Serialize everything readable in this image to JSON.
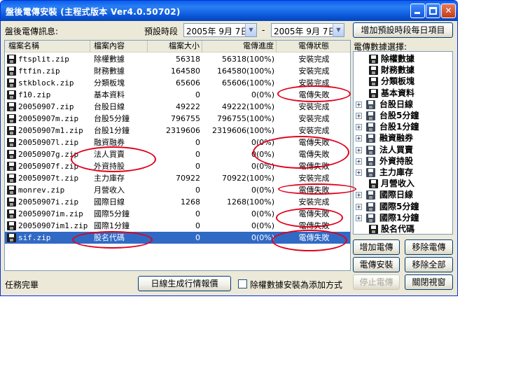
{
  "window": {
    "title": "盤後電傳安裝 (主程式版本 Ver4.0.50702)",
    "min_glyph": "_",
    "max_glyph": "□",
    "close_glyph": "✕"
  },
  "header": {
    "info_label": "盤後電傳訊息:",
    "period_label": "預設時段",
    "date_from": "2005年 9月 7日",
    "separator": "-",
    "date_to": "2005年 9月 7日",
    "add_period_button": "增加預設時段每日項目"
  },
  "table": {
    "columns": [
      "檔案名稱",
      "檔案內容",
      "檔案大小",
      "電傳進度",
      "電傳狀態"
    ],
    "rows": [
      {
        "name": "ftsplit.zip",
        "content": "除權數據",
        "size": "56318",
        "progress": "56318(100%)",
        "status": "安裝完成"
      },
      {
        "name": "ftfin.zip",
        "content": "財務數據",
        "size": "164580",
        "progress": "164580(100%)",
        "status": "安裝完成"
      },
      {
        "name": "stkblock.zip",
        "content": "分類板塊",
        "size": "65606",
        "progress": "65606(100%)",
        "status": "安裝完成"
      },
      {
        "name": "f10.zip",
        "content": "基本資料",
        "size": "0",
        "progress": "0(0%)",
        "status": "電傳失敗"
      },
      {
        "name": "20050907.zip",
        "content": "台股日線",
        "size": "49222",
        "progress": "49222(100%)",
        "status": "安裝完成"
      },
      {
        "name": "20050907m.zip",
        "content": "台股5分鐘",
        "size": "796755",
        "progress": "796755(100%)",
        "status": "安裝完成"
      },
      {
        "name": "20050907m1.zip",
        "content": "台股1分鐘",
        "size": "2319606",
        "progress": "2319606(100%)",
        "status": "安裝完成"
      },
      {
        "name": "20050907l.zip",
        "content": "融資融券",
        "size": "0",
        "progress": "0(0%)",
        "status": "電傳失敗"
      },
      {
        "name": "20050907g.zip",
        "content": "法人買賣",
        "size": "0",
        "progress": "0(0%)",
        "status": "電傳失敗"
      },
      {
        "name": "20050907f.zip",
        "content": "外資持股",
        "size": "0",
        "progress": "0(0%)",
        "status": "電傳失敗"
      },
      {
        "name": "20050907t.zip",
        "content": "主力庫存",
        "size": "70922",
        "progress": "70922(100%)",
        "status": "安裝完成"
      },
      {
        "name": "monrev.zip",
        "content": "月營收入",
        "size": "0",
        "progress": "0(0%)",
        "status": "電傳失敗"
      },
      {
        "name": "20050907i.zip",
        "content": "國際日線",
        "size": "1268",
        "progress": "1268(100%)",
        "status": "安裝完成"
      },
      {
        "name": "20050907im.zip",
        "content": "國際5分鐘",
        "size": "0",
        "progress": "0(0%)",
        "status": "電傳失敗"
      },
      {
        "name": "20050907im1.zip",
        "content": "國際1分鐘",
        "size": "0",
        "progress": "0(0%)",
        "status": "電傳失敗"
      },
      {
        "name": "sif.zip",
        "content": "股名代碼",
        "size": "0",
        "progress": "0(0%)",
        "status": "電傳失敗"
      }
    ]
  },
  "tree": {
    "label": "電傳數據選擇:",
    "expand_glyph": "+",
    "items": [
      {
        "label": "除權數據",
        "expandable": false
      },
      {
        "label": "財務數據",
        "expandable": false
      },
      {
        "label": "分類板塊",
        "expandable": false
      },
      {
        "label": "基本資料",
        "expandable": false
      },
      {
        "label": "台股日線",
        "expandable": true
      },
      {
        "label": "台股5分鐘",
        "expandable": true
      },
      {
        "label": "台股1分鐘",
        "expandable": true
      },
      {
        "label": "融資融券",
        "expandable": true
      },
      {
        "label": "法人買賣",
        "expandable": true
      },
      {
        "label": "外資持股",
        "expandable": true
      },
      {
        "label": "主力庫存",
        "expandable": true
      },
      {
        "label": "月營收入",
        "expandable": false
      },
      {
        "label": "國際日線",
        "expandable": true
      },
      {
        "label": "國際5分鐘",
        "expandable": true
      },
      {
        "label": "國際1分鐘",
        "expandable": true
      },
      {
        "label": "股名代碼",
        "expandable": false
      }
    ]
  },
  "buttons": {
    "add_transfer": "增加電傳",
    "remove_transfer": "移除電傳",
    "install": "電傳安裝",
    "remove_all": "移除全部",
    "stop": "停止電傳",
    "close": "關閉視窗",
    "gen_daily_report": "日線生成行情報價"
  },
  "footer": {
    "status": "任務完畢",
    "checkbox_label": "除權數據安裝為添加方式"
  }
}
